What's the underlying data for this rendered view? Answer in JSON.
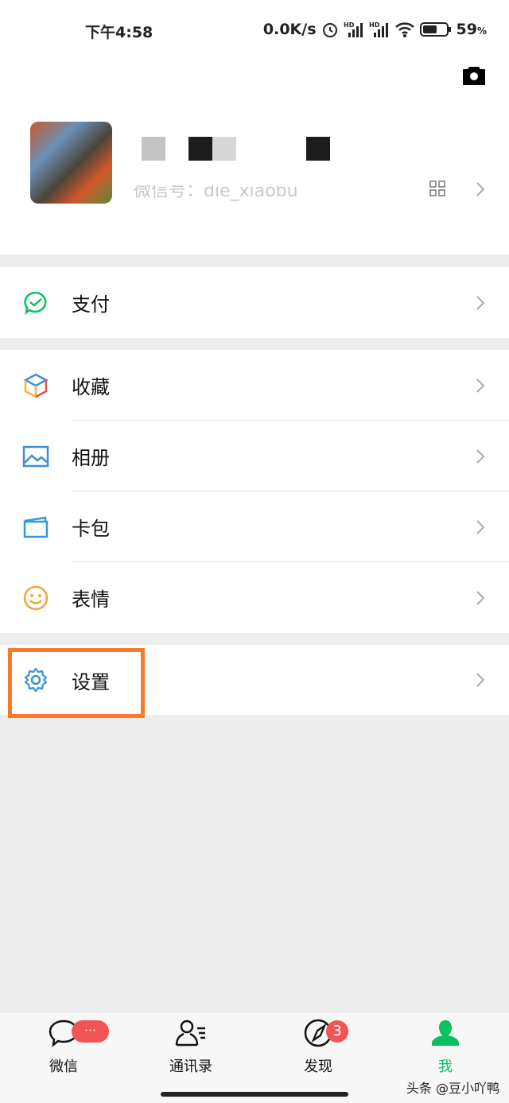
{
  "status": {
    "time": "下午4:58",
    "speed": "0.0K/s",
    "battery": "59",
    "battery_unit": "%"
  },
  "profile": {
    "wechat_id": "微信号：die_xiaobu"
  },
  "menu": {
    "pay": {
      "label": "支付",
      "icon": "wechat-pay-icon"
    },
    "items": [
      {
        "label": "收藏",
        "icon": "favorites-cube-icon"
      },
      {
        "label": "相册",
        "icon": "album-image-icon"
      },
      {
        "label": "卡包",
        "icon": "card-wallet-icon"
      },
      {
        "label": "表情",
        "icon": "smiley-icon"
      }
    ],
    "settings": {
      "label": "设置",
      "icon": "gear-icon"
    }
  },
  "tabs": [
    {
      "label": "微信",
      "badge": "···"
    },
    {
      "label": "通讯录"
    },
    {
      "label": "发现",
      "badge": "3"
    },
    {
      "label": "我",
      "active": true
    }
  ],
  "colors": {
    "accent": "#07c160",
    "badge": "#f25454",
    "highlight": "#fa7a28"
  },
  "watermark": "头条 @豆小吖鸭"
}
